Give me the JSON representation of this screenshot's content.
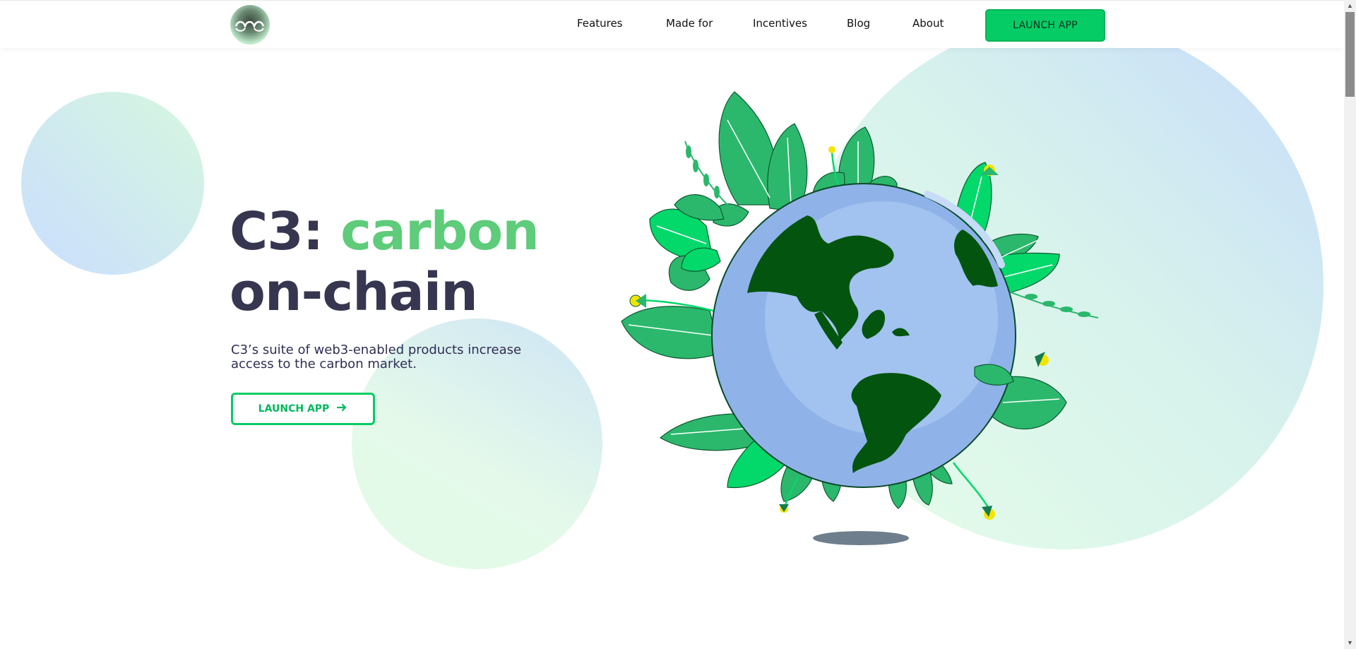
{
  "nav": {
    "logo": "c3-logo-icon",
    "links": [
      "Features",
      "Made for",
      "Incentives",
      "Blog",
      "About"
    ],
    "launch_label": "LAUNCH APP"
  },
  "hero": {
    "title_prefix": "C3:",
    "title_accent": "carbon",
    "title_line2": "on-chain",
    "subtitle": "C3’s suite of web3-enabled products increase access to the carbon market.",
    "cta_label": "LAUNCH APP",
    "cta_icon": "arrow-right-icon",
    "illustration": "globe-with-plants"
  },
  "colors": {
    "brand_green": "#06cc66",
    "accent_green": "#5ecc7a",
    "heading": "#363650",
    "globe_ocean": "#9ec0ee",
    "land": "#02540f"
  }
}
